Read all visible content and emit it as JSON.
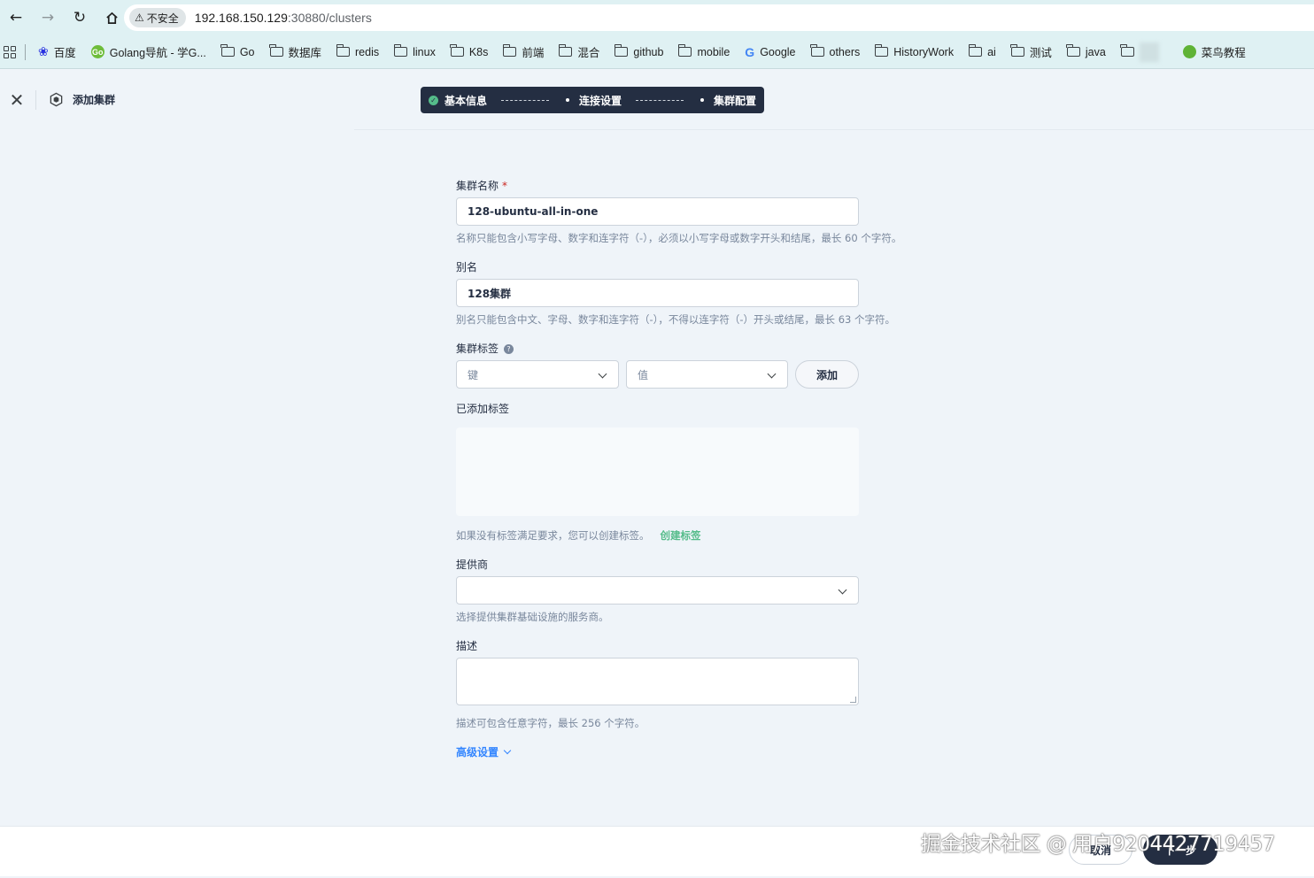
{
  "browser": {
    "security_label": "不安全",
    "url_host": "192.168.150.129",
    "url_path": ":30880/clusters",
    "bookmarks": [
      {
        "label": "百度",
        "icon": "baidu-icon"
      },
      {
        "label": "Golang导航 - 学G...",
        "icon": "golang-icon"
      },
      {
        "label": "Go",
        "icon": "folder-icon"
      },
      {
        "label": "数据库",
        "icon": "folder-icon"
      },
      {
        "label": "redis",
        "icon": "folder-icon"
      },
      {
        "label": "linux",
        "icon": "folder-icon"
      },
      {
        "label": "K8s",
        "icon": "folder-icon"
      },
      {
        "label": "前端",
        "icon": "folder-icon"
      },
      {
        "label": "混合",
        "icon": "folder-icon"
      },
      {
        "label": "github",
        "icon": "folder-icon"
      },
      {
        "label": "mobile",
        "icon": "folder-icon"
      },
      {
        "label": "Google",
        "icon": "google-icon"
      },
      {
        "label": "others",
        "icon": "folder-icon"
      },
      {
        "label": "HistoryWork",
        "icon": "folder-icon"
      },
      {
        "label": "ai",
        "icon": "folder-icon"
      },
      {
        "label": "测试",
        "icon": "folder-icon"
      },
      {
        "label": "java",
        "icon": "folder-icon"
      },
      {
        "label": "菜鸟教程",
        "icon": "runoob-icon"
      }
    ]
  },
  "header": {
    "title": "添加集群",
    "steps": [
      "基本信息",
      "连接设置",
      "集群配置"
    ]
  },
  "form": {
    "name_label": "集群名称",
    "name_required_mark": "*",
    "name_value": "128-ubuntu-all-in-one",
    "name_hint": "名称只能包含小写字母、数字和连字符（-），必须以小写字母或数字开头和结尾，最长 60 个字符。",
    "alias_label": "别名",
    "alias_value": "128集群",
    "alias_hint": "别名只能包含中文、字母、数字和连字符（-），不得以连字符（-）开头或结尾，最长 63 个字符。",
    "tags_label": "集群标签",
    "tags_help": "?",
    "key_placeholder": "键",
    "value_placeholder": "值",
    "add_button": "添加",
    "added_tags_label": "已添加标签",
    "tags_hint": "如果没有标签满足要求，您可以创建标签。",
    "create_tag_link": "创建标签",
    "provider_label": "提供商",
    "provider_value": "",
    "provider_hint": "选择提供集群基础设施的服务商。",
    "desc_label": "描述",
    "desc_hint": "描述可包含任意字符，最长 256 个字符。",
    "advanced_label": "高级设置"
  },
  "footer": {
    "cancel_label": "取消",
    "next_label": "下一步"
  },
  "watermark": "掘金技术社区 @ 用户9204427719457",
  "colors": {
    "accent_dark": "#242e42",
    "success_green": "#55bc8a",
    "link_blue": "#3385ff",
    "background": "#eff4f9"
  }
}
